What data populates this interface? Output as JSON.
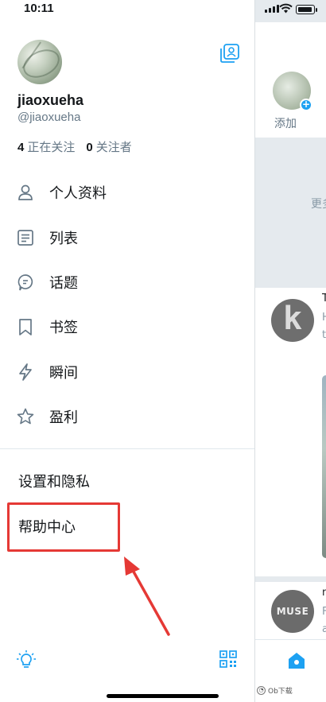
{
  "status_bar": {
    "time": "10:11"
  },
  "profile": {
    "display_name": "jiaoxueha",
    "handle": "@jiaoxueha",
    "following_count": "4",
    "following_label": "正在关注",
    "followers_count": "0",
    "followers_label": "关注者"
  },
  "menu": {
    "items": [
      {
        "label": "个人资料",
        "icon": "person-icon"
      },
      {
        "label": "列表",
        "icon": "list-icon"
      },
      {
        "label": "话题",
        "icon": "topic-icon"
      },
      {
        "label": "书签",
        "icon": "bookmark-icon"
      },
      {
        "label": "瞬间",
        "icon": "lightning-icon"
      },
      {
        "label": "盈利",
        "icon": "star-icon"
      }
    ],
    "settings_label": "设置和隐私",
    "help_label": "帮助中心"
  },
  "background": {
    "fleet_add_label": "添加",
    "more_text": "更多",
    "feed1": {
      "avatar_letter": "k",
      "line1": "T",
      "line2": "H",
      "line3": "t"
    },
    "feed2": {
      "avatar_text": "MUSE",
      "line1": "n",
      "line2": "F",
      "line3": "a"
    },
    "watermark": "Ob下载"
  },
  "colors": {
    "accent": "#1da1f2",
    "annotation": "#e53935",
    "text_secondary": "#657786"
  }
}
